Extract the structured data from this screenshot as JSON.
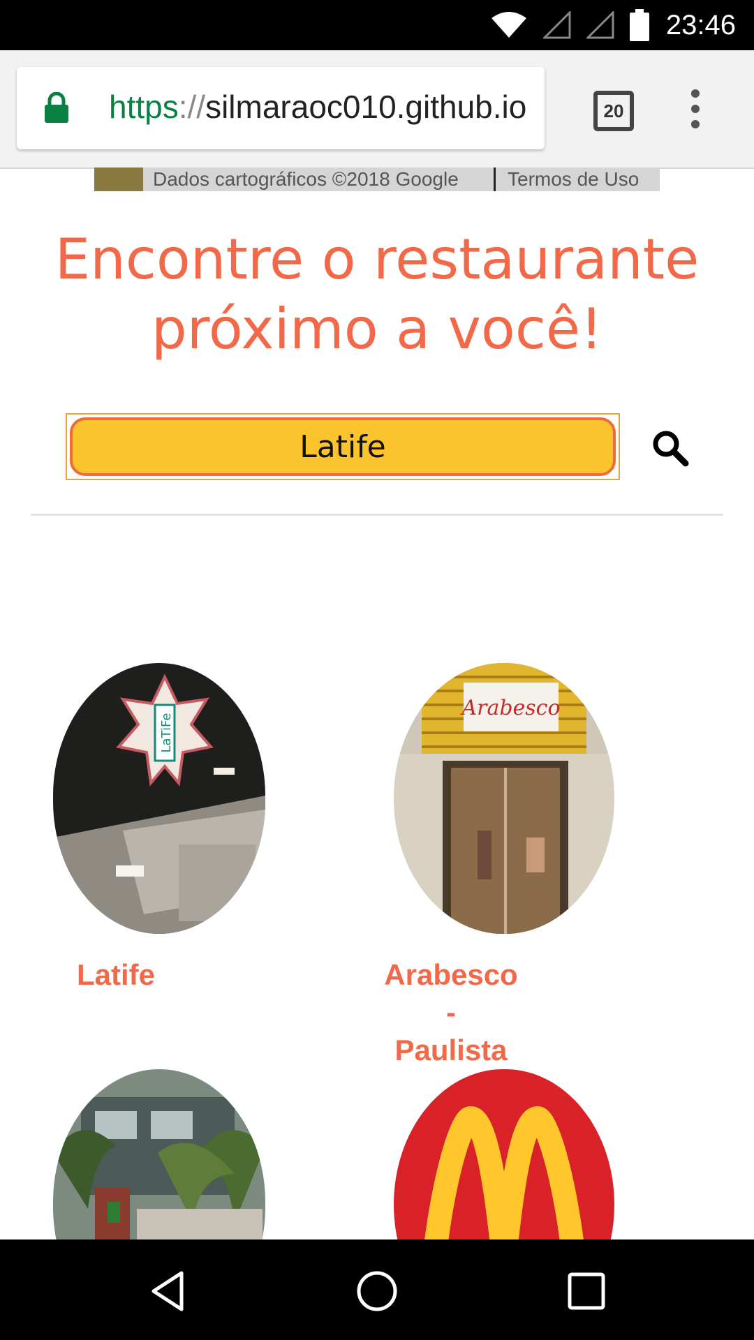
{
  "status_bar": {
    "time": "23:46",
    "icons": [
      "wifi-icon",
      "signal-icon",
      "signal-icon",
      "battery-icon"
    ]
  },
  "browser": {
    "url_scheme": "https",
    "url_sep": "://",
    "url_host": "silmaraoc010.github.io",
    "tab_count": "20"
  },
  "map": {
    "attribution": "Dados cartográficos ©2018 Google",
    "terms": "Termos de Uso"
  },
  "page": {
    "heading_line1": "Encontre o restaurante",
    "heading_line2": "próximo a você!",
    "search_value": "Latife",
    "search_icon": "search-icon"
  },
  "restaurants": [
    {
      "name": "Latife"
    },
    {
      "name_line1": "Arabesco -",
      "name_line2": "Paulista"
    },
    {
      "name": ""
    },
    {
      "name": ""
    }
  ],
  "colors": {
    "accent": "#f2694a",
    "search_fill": "#fbc42c",
    "search_border": "#f26a3c",
    "mcd_red": "#d92128",
    "mcd_yellow": "#ffc72c"
  },
  "nav": [
    "back-icon",
    "home-icon",
    "recents-icon"
  ]
}
